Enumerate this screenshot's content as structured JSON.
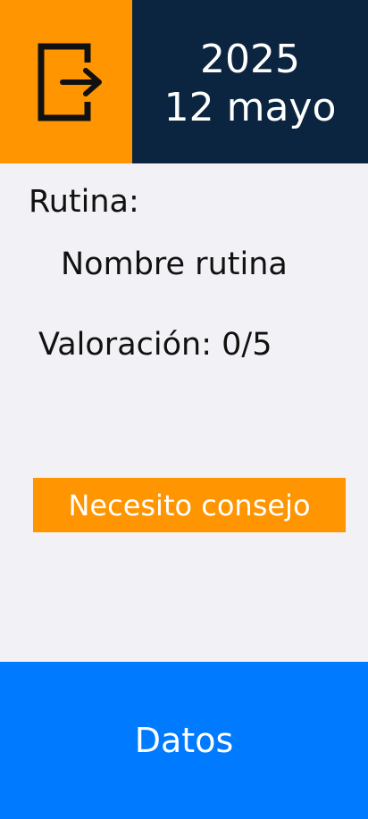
{
  "header": {
    "logout_icon": "logout-icon",
    "year": "2025",
    "day": "12 mayo"
  },
  "routine": {
    "label": "Rutina:",
    "name": "Nombre rutina",
    "rating": "Valoración: 0/5"
  },
  "actions": {
    "advice_label": "Necesito consejo",
    "data_label": "Datos"
  },
  "colors": {
    "orange": "#ff9500",
    "navy": "#0b2540",
    "blue": "#007aff",
    "background": "#f2f2f6"
  }
}
